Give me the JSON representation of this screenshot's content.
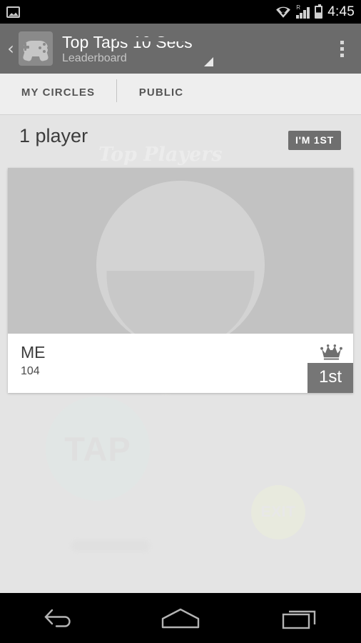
{
  "status_bar": {
    "time": "4:45",
    "icons": [
      "image-icon",
      "wifi-icon",
      "roaming-signal-icon",
      "battery-icon"
    ],
    "roaming_label": "R"
  },
  "action_bar": {
    "back_label": "‹",
    "app_icon": "gamepad-icon",
    "title": "Top Taps 10 Secs",
    "subtitle": "Leaderboard",
    "spinner_icon": "dropdown-triangle-icon",
    "overflow_icon": "overflow-menu-icon",
    "background_color": "#6b6b6b"
  },
  "tabs": {
    "items": [
      {
        "label": "MY CIRCLES",
        "selected": false
      },
      {
        "label": "PUBLIC",
        "selected": true
      }
    ],
    "indicator_color": "#6b6b6b"
  },
  "list_header": {
    "player_count": "1 player",
    "badge_label": "I'M 1ST",
    "badge_color": "#6f6f6f"
  },
  "player_card": {
    "avatar": "default-person-avatar",
    "name": "ME",
    "score": "104",
    "crown_icon": "crown-icon",
    "rank_label": "1st",
    "rank_badge_color": "#767676"
  },
  "background_watermarks": {
    "script_text": "Top Players",
    "tap_label": "TAP",
    "exit_label": "EXIT"
  },
  "nav_bar": {
    "buttons": [
      {
        "name": "back",
        "icon": "back-arrow-icon"
      },
      {
        "name": "home",
        "icon": "home-icon"
      },
      {
        "name": "recents",
        "icon": "recents-icon"
      }
    ]
  }
}
